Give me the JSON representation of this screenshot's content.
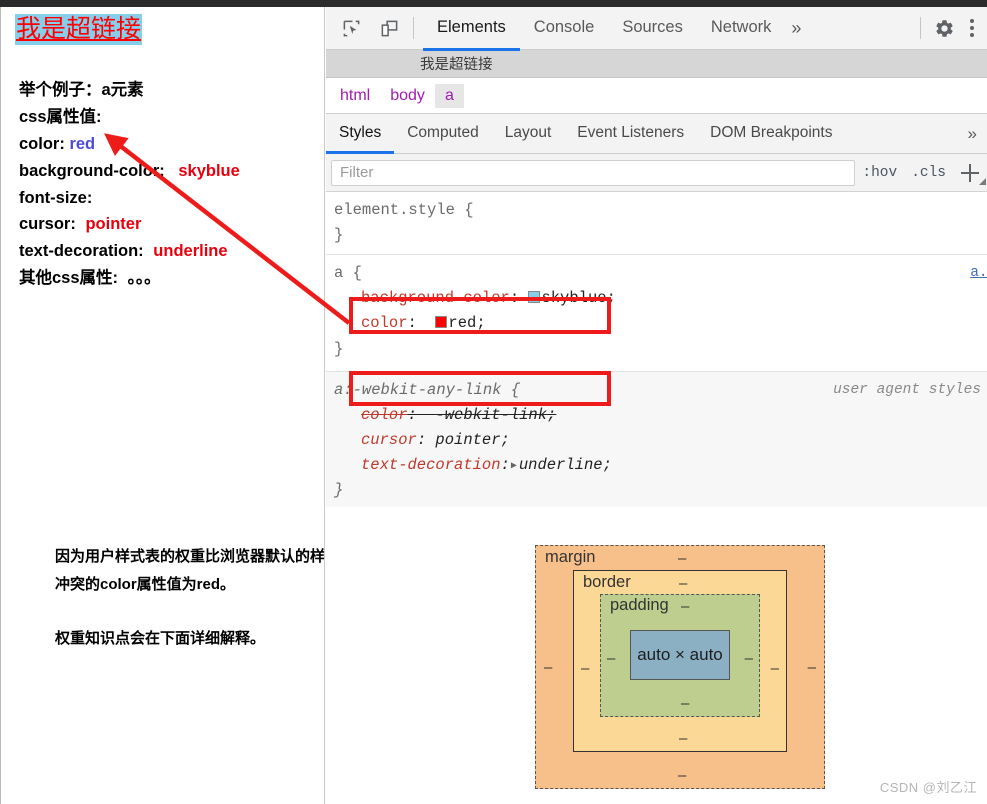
{
  "page": {
    "link_text": "我是超链接",
    "props_title": "举个例子：a元素",
    "props_subtitle": "css属性值:",
    "props": [
      {
        "name": "color:",
        "value": "red",
        "value_style": "blue"
      },
      {
        "name": "background-color:",
        "value": "skyblue",
        "value_style": "red"
      },
      {
        "name": "font-size:",
        "value": "",
        "value_style": "red"
      },
      {
        "name": "cursor:",
        "value": "pointer",
        "value_style": "red"
      },
      {
        "name": "text-decoration:",
        "value": "underline",
        "value_style": "red"
      },
      {
        "name": "其他css属性:",
        "value": "。。。",
        "value_style": "black"
      }
    ],
    "note_line1": "因为用户样式表的权重比浏览器默认的样式表权重大，所以",
    "note_line2": "冲突的color属性值为red。",
    "note_line3": "权重知识点会在下面详细解释。"
  },
  "devtools": {
    "toolbar": {
      "inspect_icon": "inspect-element-icon",
      "device_icon": "device-toolbar-icon",
      "settings_icon": "gear-icon",
      "kebab_icon": "more-options-icon",
      "tabs": [
        {
          "label": "Elements",
          "active": true
        },
        {
          "label": "Console",
          "active": false
        },
        {
          "label": "Sources",
          "active": false
        },
        {
          "label": "Network",
          "active": false
        }
      ],
      "more_label": "»"
    },
    "dom": {
      "node_text": "我是超链接"
    },
    "breadcrumb": [
      {
        "label": "html",
        "selected": false
      },
      {
        "label": "body",
        "selected": false
      },
      {
        "label": "a",
        "selected": true
      }
    ],
    "sidebar_tabs": [
      {
        "label": "Styles",
        "active": true
      },
      {
        "label": "Computed",
        "active": false
      },
      {
        "label": "Layout",
        "active": false
      },
      {
        "label": "Event Listeners",
        "active": false
      },
      {
        "label": "DOM Breakpoints",
        "active": false
      }
    ],
    "sidebar_more_label": "»",
    "filter": {
      "placeholder": "Filter",
      "value": "",
      "hov_label": ":hov",
      "cls_label": ".cls",
      "new_rule_icon": "plus-icon"
    },
    "rules": [
      {
        "selector": "element.style {",
        "close": "}",
        "origin": "",
        "file": "",
        "declarations": []
      },
      {
        "selector": "a {",
        "close": "}",
        "origin": "",
        "file": "a.ht",
        "declarations": [
          {
            "prop": "background-color",
            "value": "skyblue",
            "swatch": "#87ceeb",
            "struck": false
          },
          {
            "prop": "color",
            "value": "red",
            "swatch": "#ff0000",
            "struck": false
          }
        ]
      },
      {
        "selector": "a:-webkit-any-link {",
        "close": "}",
        "origin": "user agent styles",
        "file": "",
        "ua": true,
        "declarations": [
          {
            "prop": "color",
            "value": "-webkit-link",
            "swatch": "",
            "struck": true
          },
          {
            "prop": "cursor",
            "value": "pointer",
            "swatch": "",
            "struck": false
          },
          {
            "prop": "text-decoration",
            "value": "underline",
            "swatch": "",
            "struck": false,
            "expandable": true
          }
        ]
      }
    ],
    "box_model": {
      "margin_label": "margin",
      "border_label": "border",
      "padding_label": "padding",
      "content_label": "auto × auto",
      "dash": "–",
      "colors": {
        "margin": "#f7c08a",
        "border": "#fbd896",
        "padding": "#bdce8e",
        "content": "#8bb0c4"
      }
    }
  },
  "watermark": "CSDN @刘乙江",
  "accent": {
    "annotation_red": "#ee1b1b",
    "tab_blue": "#1a73e8",
    "link_purple": "#a11cb0"
  }
}
